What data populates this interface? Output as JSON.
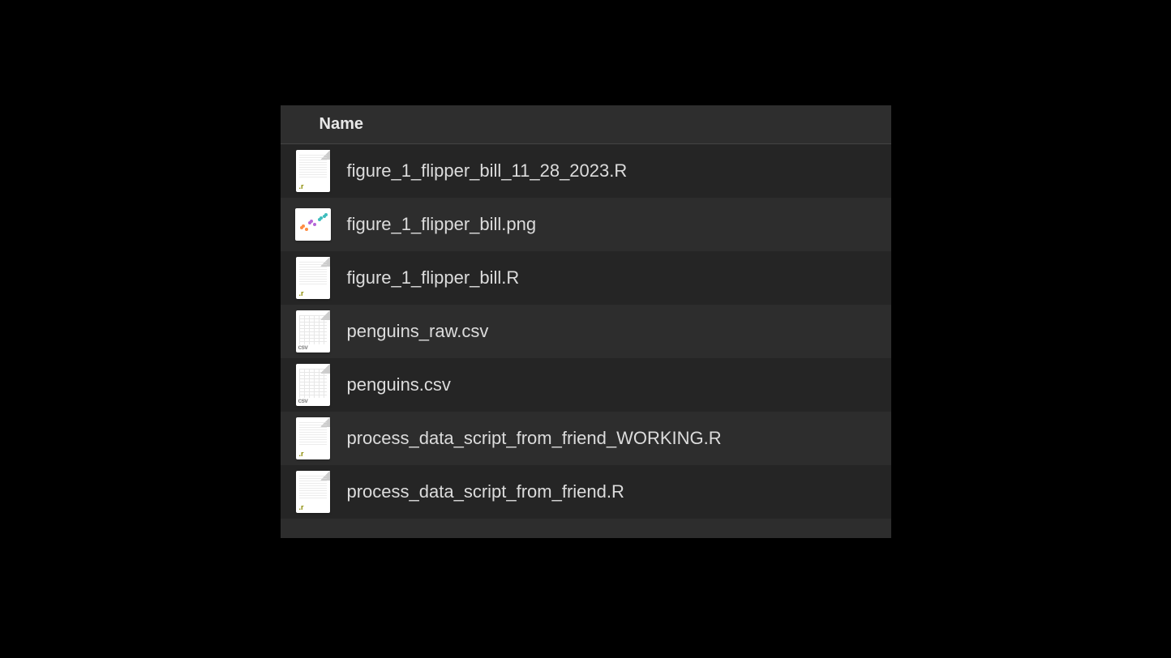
{
  "header": {
    "name_label": "Name"
  },
  "files": [
    {
      "name": "figure_1_flipper_bill_11_28_2023.R",
      "type": "r"
    },
    {
      "name": "figure_1_flipper_bill.png",
      "type": "png"
    },
    {
      "name": "figure_1_flipper_bill.R",
      "type": "r"
    },
    {
      "name": "penguins_raw.csv",
      "type": "csv"
    },
    {
      "name": "penguins.csv",
      "type": "csv"
    },
    {
      "name": "process_data_script_from_friend_WORKING.R",
      "type": "r"
    },
    {
      "name": "process_data_script_from_friend.R",
      "type": "r"
    }
  ]
}
